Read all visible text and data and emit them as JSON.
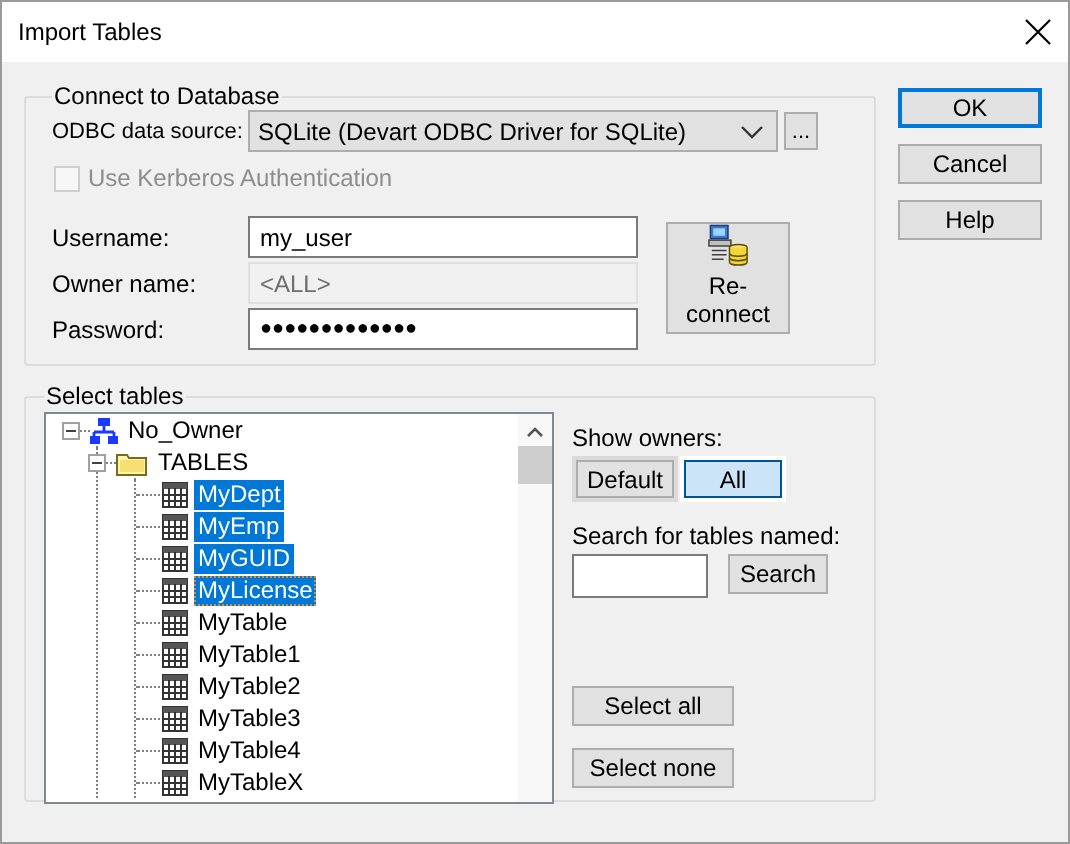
{
  "window": {
    "title": "Import Tables"
  },
  "connect": {
    "title": "Connect to Database",
    "odbc_label": "ODBC data source:",
    "odbc_value": "SQLite (Devart ODBC Driver for SQLite)",
    "browse_button": "...",
    "kerberos": {
      "label": "Use Kerberos Authentication",
      "checked": false,
      "disabled": true
    },
    "fields": [
      {
        "label": "Username:",
        "value": "my_user",
        "disabled": false
      },
      {
        "label": "Owner name:",
        "value": "<ALL>",
        "disabled": true
      },
      {
        "label": "Password:",
        "value": "●●●●●●●●●●●●●",
        "disabled": false
      }
    ],
    "reconnect_button": "Re-connect"
  },
  "select": {
    "title": "Select tables",
    "tree": [
      {
        "label": "No_Owner",
        "kind": "owner",
        "expanded": true,
        "children": [
          {
            "label": "TABLES",
            "kind": "folder",
            "expanded": true,
            "children": [
              {
                "label": "MyDept",
                "kind": "table",
                "selected": true,
                "focused": false
              },
              {
                "label": "MyEmp",
                "kind": "table",
                "selected": true,
                "focused": false
              },
              {
                "label": "MyGUID",
                "kind": "table",
                "selected": true,
                "focused": false
              },
              {
                "label": "MyLicense",
                "kind": "table",
                "selected": true,
                "focused": true
              },
              {
                "label": "MyTable",
                "kind": "table",
                "selected": false,
                "focused": false
              },
              {
                "label": "MyTable1",
                "kind": "table",
                "selected": false,
                "focused": false
              },
              {
                "label": "MyTable2",
                "kind": "table",
                "selected": false,
                "focused": false
              },
              {
                "label": "MyTable3",
                "kind": "table",
                "selected": false,
                "focused": false
              },
              {
                "label": "MyTable4",
                "kind": "table",
                "selected": false,
                "focused": false
              },
              {
                "label": "MyTableX",
                "kind": "table",
                "selected": false,
                "focused": false
              }
            ]
          }
        ]
      }
    ],
    "show_owners_label": "Show owners:",
    "owner_options": [
      {
        "label": "Default",
        "selected": false
      },
      {
        "label": "All",
        "selected": true
      }
    ],
    "search_label": "Search for tables named:",
    "search_button": "Search",
    "select_all_button": "Select all",
    "select_none_button": "Select none"
  },
  "buttons": [
    {
      "label": "OK",
      "default": true
    },
    {
      "label": "Cancel",
      "default": false
    },
    {
      "label": "Help",
      "default": false
    }
  ]
}
